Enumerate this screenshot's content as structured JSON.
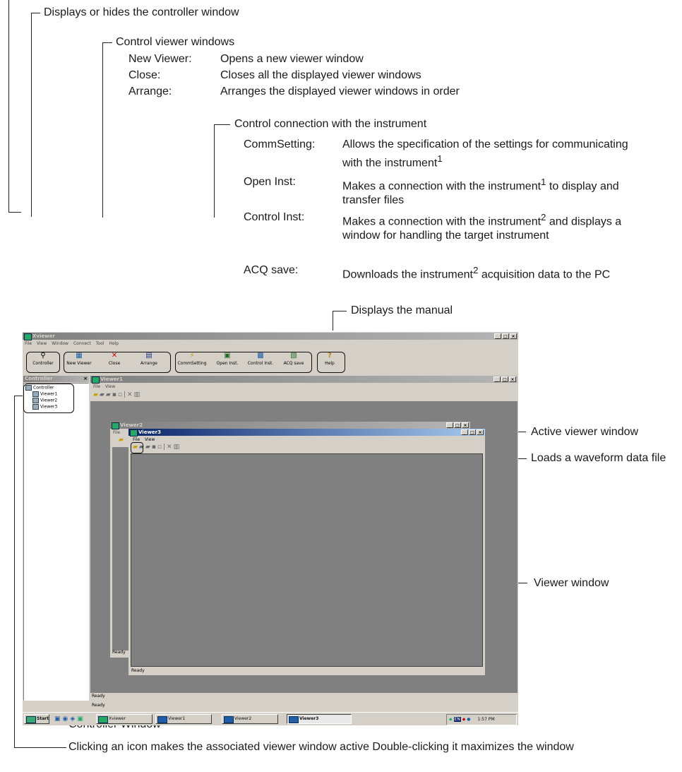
{
  "annotations": {
    "controller_toggle": "Displays or hides the controller window",
    "control_viewers": {
      "heading": "Control viewer windows",
      "items": [
        {
          "term": "New Viewer:",
          "desc": "Opens a new viewer window"
        },
        {
          "term": "Close:",
          "desc": "Closes all the displayed viewer windows"
        },
        {
          "term": "Arrange:",
          "desc": "Arranges the displayed viewer windows in order"
        }
      ]
    },
    "control_connection": {
      "heading": "Control connection with the instrument",
      "items": [
        {
          "term": "CommSetting:",
          "desc": "Allows the specification of the settings for communicating with the instrument",
          "sup": "1",
          "desc_after": ""
        },
        {
          "term": "Open Inst:",
          "desc": "Makes a connection with the instrument",
          "sup": "1",
          "desc_after": " to display and transfer files"
        },
        {
          "term": "Control Inst:",
          "desc": "Makes a connection with the instrument",
          "sup": "2",
          "desc_after": " and displays a window for handling the target instrument"
        },
        {
          "term": "ACQ save:",
          "desc": "Downloads the instrument",
          "sup": "2",
          "desc_after": " acquisition data to the PC"
        }
      ]
    },
    "manual": "Displays the manual",
    "active_viewer": "Active viewer window",
    "load_waveform": "Loads a waveform data file",
    "viewer_window": "Viewer window",
    "controller_window": "Controller Window",
    "clicking_icon": "Clicking an icon makes the associated viewer window active Double-clicking it maximizes the window"
  },
  "app": {
    "title": "Xviewer",
    "menu": [
      "File",
      "View",
      "Window",
      "Connect",
      "Tool",
      "Help"
    ],
    "toolbar": [
      {
        "label": "Controller",
        "icon": "controller-icon",
        "glyph": "⚲"
      },
      {
        "label": "New Viewer",
        "icon": "new-viewer-icon",
        "glyph": "▦"
      },
      {
        "label": "Close",
        "icon": "close-icon",
        "glyph": "✕"
      },
      {
        "label": "Arrange",
        "icon": "arrange-icon",
        "glyph": "▤"
      },
      {
        "label": "CommSetting",
        "icon": "comm-setting-icon",
        "glyph": "⚡"
      },
      {
        "label": "Open Inst.",
        "icon": "open-inst-icon",
        "glyph": "▣"
      },
      {
        "label": "Control Inst.",
        "icon": "control-inst-icon",
        "glyph": "▩"
      },
      {
        "label": "ACQ save",
        "icon": "acq-save-icon",
        "glyph": "▧"
      },
      {
        "label": "Help",
        "icon": "help-icon",
        "glyph": "?"
      }
    ],
    "controller_panel": {
      "title": "Controller",
      "root": "Controller",
      "items": [
        "Viewer1",
        "Viewer2",
        "Viewer3"
      ],
      "selected": "Viewer2"
    },
    "viewer1": {
      "title": "Viewer1",
      "menu": [
        "File",
        "View"
      ],
      "status": "Ready"
    },
    "viewer2": {
      "title": "Viewer2",
      "menu": [
        "File"
      ],
      "status": "Ready"
    },
    "viewer3": {
      "title": "Viewer3",
      "menu": [
        "File",
        "View"
      ],
      "status": "Ready"
    },
    "taskbar": {
      "start": "Start",
      "buttons": [
        "Xviewer",
        "Viewer1",
        "Viewer2",
        "Viewer3"
      ],
      "active": "Viewer3",
      "tray_lang": "EN",
      "clock": "1:57 PM"
    }
  },
  "colors": {
    "title_active": "#0a246a",
    "title_inactive": "#808080",
    "face": "#d4d0c8",
    "workspace": "#808080"
  }
}
